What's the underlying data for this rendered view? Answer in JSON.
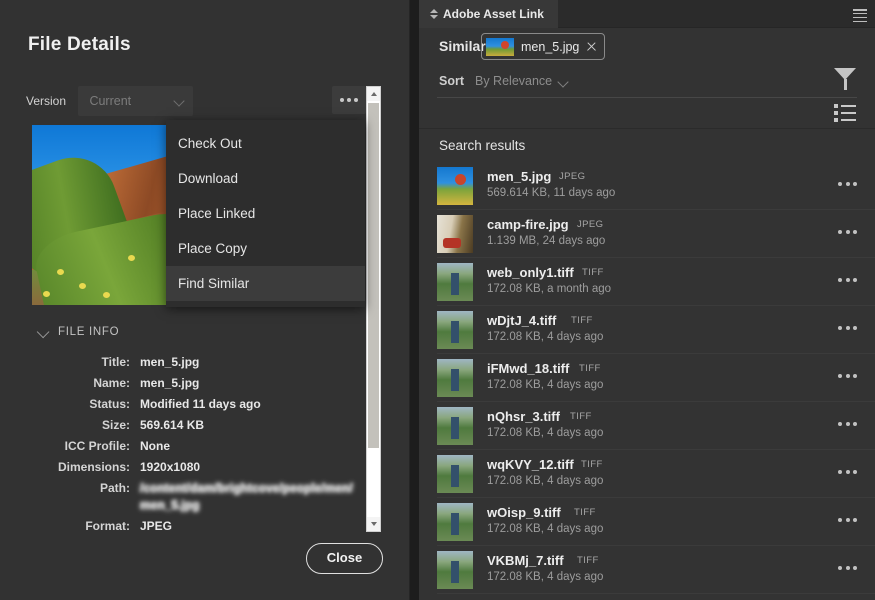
{
  "file_details": {
    "title": "File Details",
    "version_label": "Version",
    "version_value": "Current",
    "more_button_label": "•••",
    "close_label": "Close",
    "file_info_header": "FILE INFO",
    "info_rows": [
      {
        "key": "Title:",
        "value": "men_5.jpg",
        "blurred": false
      },
      {
        "key": "Name:",
        "value": "men_5.jpg",
        "blurred": false
      },
      {
        "key": "Status:",
        "value": "Modified 11 days ago",
        "blurred": false
      },
      {
        "key": "Size:",
        "value": "569.614 KB",
        "blurred": false
      },
      {
        "key": "ICC Profile:",
        "value": "None",
        "blurred": false
      },
      {
        "key": "Dimensions:",
        "value": "1920x1080",
        "blurred": false
      },
      {
        "key": "Path:",
        "value": "/content/dam/brightcove/people/men/men_5.jpg",
        "blurred": true
      },
      {
        "key": "Format:",
        "value": "JPEG",
        "blurred": false
      }
    ],
    "context_menu": {
      "items": [
        {
          "label": "Check Out",
          "highlighted": false
        },
        {
          "label": "Download",
          "highlighted": false
        },
        {
          "label": "Place Linked",
          "highlighted": false
        },
        {
          "label": "Place Copy",
          "highlighted": false
        },
        {
          "label": "Find Similar",
          "highlighted": true
        }
      ]
    }
  },
  "asset_link": {
    "tab_label": "Adobe Asset Link",
    "similar_label": "Similar",
    "similar_chip_name": "men_5.jpg",
    "sort_label": "Sort",
    "sort_value": "By Relevance",
    "results_title": "Search results",
    "results": [
      {
        "name": "men_5.jpg",
        "type": "JPEG",
        "meta": "569.614 KB, 11 days ago",
        "thumb": "k-men"
      },
      {
        "name": "camp-fire.jpg",
        "type": "JPEG",
        "meta": "1.139 MB, 24 days ago",
        "thumb": "k-camp"
      },
      {
        "name": "web_only1.tiff",
        "type": "TIFF",
        "meta": "172.08 KB, a month ago",
        "thumb": "k-web"
      },
      {
        "name": "wDjtJ_4.tiff",
        "type": "TIFF",
        "meta": "172.08 KB, 4 days ago",
        "thumb": "k-web"
      },
      {
        "name": "iFMwd_18.tiff",
        "type": "TIFF",
        "meta": "172.08 KB, 4 days ago",
        "thumb": "k-web"
      },
      {
        "name": "nQhsr_3.tiff",
        "type": "TIFF",
        "meta": "172.08 KB, 4 days ago",
        "thumb": "k-web"
      },
      {
        "name": "wqKVY_12.tiff",
        "type": "TIFF",
        "meta": "172.08 KB, 4 days ago",
        "thumb": "k-web"
      },
      {
        "name": "wOisp_9.tiff",
        "type": "TIFF",
        "meta": "172.08 KB, 4 days ago",
        "thumb": "k-web"
      },
      {
        "name": "VKBMj_7.tiff",
        "type": "TIFF",
        "meta": "172.08 KB, 4 days ago",
        "thumb": "k-web"
      }
    ]
  },
  "colors": {
    "panel_bg": "#323232",
    "aal_bg": "#333333",
    "menu_bg": "#2d2d2d",
    "menu_highlight": "#3c3c3c",
    "text_primary": "#ededed",
    "text_muted": "#9d9d9d",
    "scrollbar_thumb": "#c3c1bb"
  }
}
